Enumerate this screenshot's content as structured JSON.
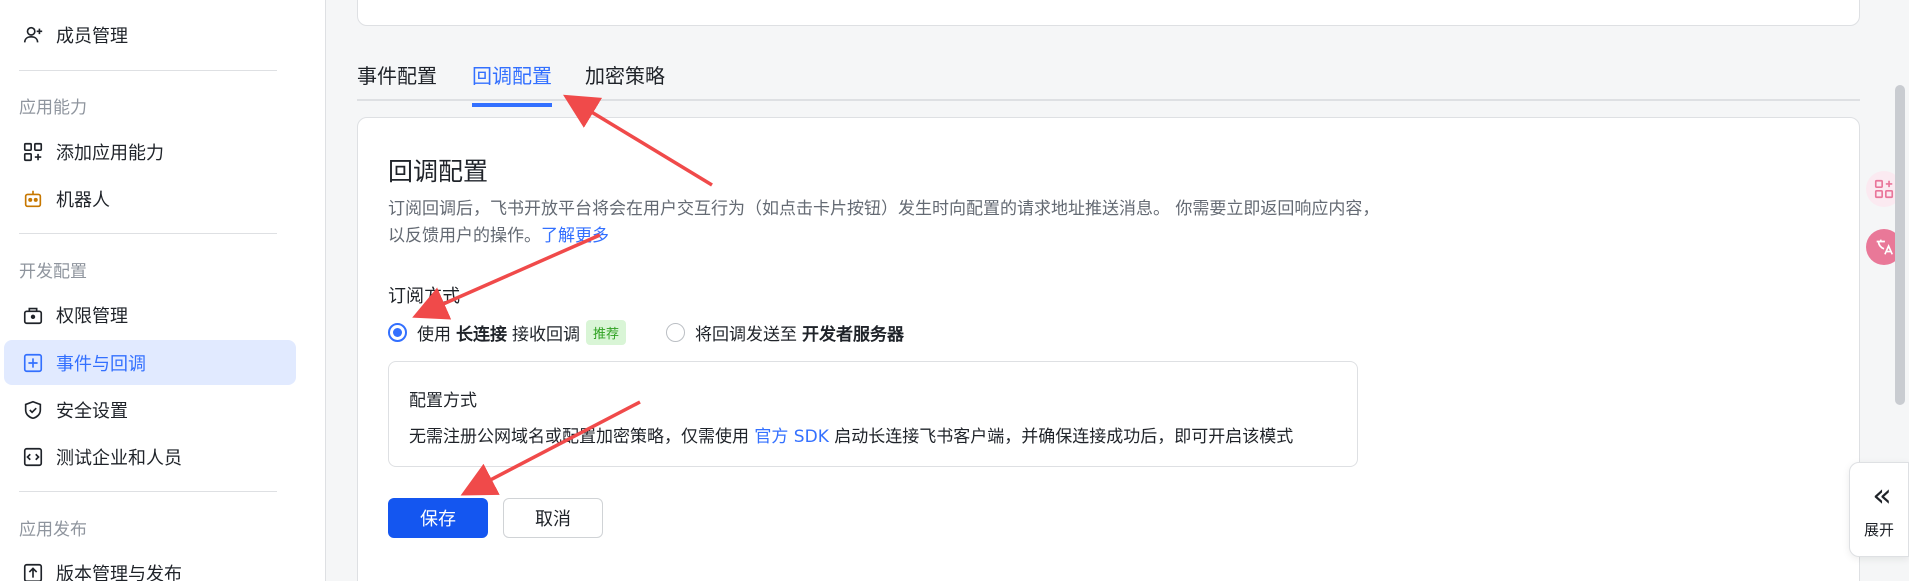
{
  "sidebar": {
    "items": [
      {
        "label": "成员管理",
        "icon": "user-plus-icon",
        "active": false
      },
      {
        "label": "添加应用能力",
        "icon": "apps-add-icon",
        "active": false
      },
      {
        "label": "机器人",
        "icon": "robot-icon",
        "active": false
      },
      {
        "label": "权限管理",
        "icon": "lock-bag-icon",
        "active": false
      },
      {
        "label": "事件与回调",
        "icon": "event-icon",
        "active": true
      },
      {
        "label": "安全设置",
        "icon": "shield-icon",
        "active": false
      },
      {
        "label": "测试企业和人员",
        "icon": "code-icon",
        "active": false
      },
      {
        "label": "版本管理与发布",
        "icon": "upload-icon",
        "active": false
      }
    ],
    "sections": [
      "应用能力",
      "开发配置",
      "应用发布"
    ]
  },
  "tabs": [
    {
      "label": "事件配置",
      "active": false
    },
    {
      "label": "回调配置",
      "active": true
    },
    {
      "label": "加密策略",
      "active": false
    }
  ],
  "card": {
    "title": "回调配置",
    "description": "订阅回调后，飞书开放平台将会在用户交互行为（如点击卡片按钮）发生时向配置的请求地址推送消息。 你需要立即返回响应内容，以反馈用户的操作。",
    "learn_more": "了解更多",
    "subscribe_label": "订阅方式",
    "option1": {
      "prefix": "使用",
      "bold": "长连接",
      "suffix": "接收回调",
      "tag": "推荐",
      "checked": true
    },
    "option2": {
      "prefix": "将回调发送至",
      "bold": "开发者服务器",
      "checked": false
    },
    "config": {
      "title": "配置方式",
      "text_before": "无需注册公网域名或配置加密策略，仅需使用",
      "link": "官方 SDK",
      "text_after": "启动长连接飞书客户端，并确保连接成功后，即可开启该模式"
    },
    "save_label": "保存",
    "cancel_label": "取消"
  },
  "right_panel": {
    "expand_label": "展开"
  },
  "colors": {
    "accent": "#3370ff",
    "primary_button": "#1456f0",
    "active_nav_bg": "#e1eaff",
    "annotation_arrow": "#f04a4a"
  }
}
